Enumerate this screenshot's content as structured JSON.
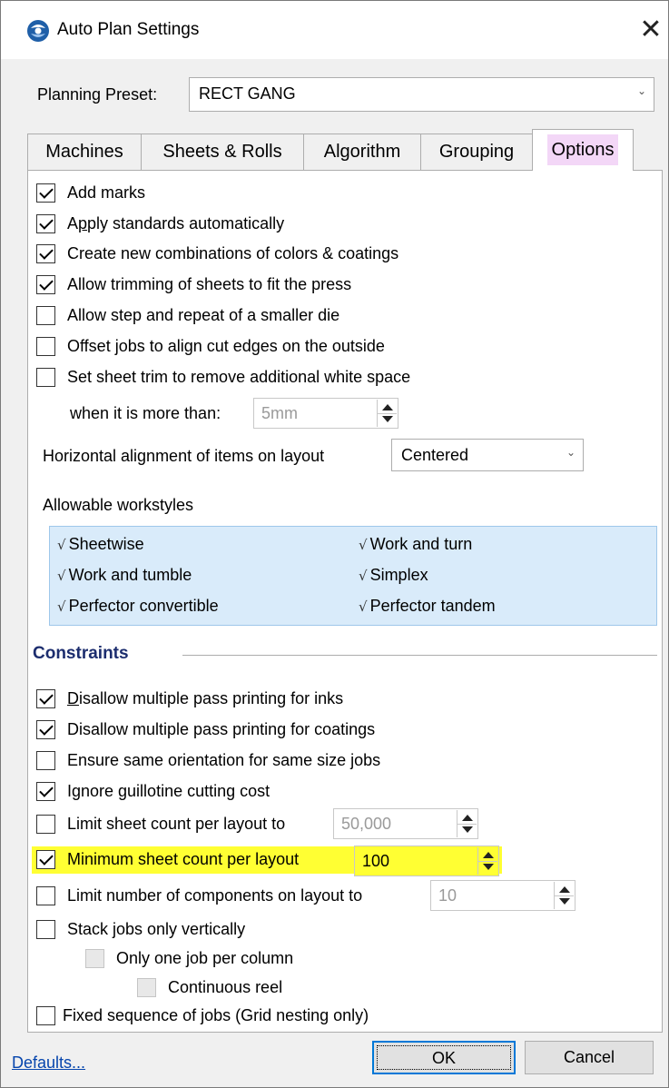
{
  "window": {
    "title": "Auto Plan Settings",
    "close_glyph": "✕"
  },
  "preset": {
    "label": "Planning Preset:",
    "value": "RECT GANG",
    "chevron": "⌄"
  },
  "tabs": [
    {
      "label": "Machines"
    },
    {
      "label": "Sheets & Rolls"
    },
    {
      "label": "Algorithm"
    },
    {
      "label": "Grouping"
    },
    {
      "label": "Options",
      "active": true
    }
  ],
  "options": {
    "add_marks": {
      "label": "Add marks",
      "checked": true
    },
    "apply_standards": {
      "label_pre": "A",
      "label_u": "p",
      "label_post": "ply standards automatically",
      "checked": true
    },
    "create_combinations": {
      "label": "Create new combinations of colors & coatings",
      "checked": true
    },
    "allow_trimming": {
      "label": "Allow trimming of sheets to fit the press",
      "checked": true
    },
    "allow_step_repeat": {
      "label": "Allow step and repeat of a smaller die",
      "checked": false
    },
    "offset_jobs": {
      "label": "Offset jobs to align cut edges on the outside",
      "checked": false
    },
    "set_sheet_trim": {
      "label": "Set sheet trim to remove additional white space",
      "checked": false
    },
    "trim_threshold": {
      "label": "when it is more than:",
      "value": "5mm"
    },
    "horizontal_alignment": {
      "label": "Horizontal alignment of items on layout",
      "value": "Centered",
      "chevron": "⌄"
    },
    "workstyles": {
      "label": "Allowable workstyles",
      "tick": "√",
      "items": [
        "Sheetwise",
        "Work and turn",
        "Work and tumble",
        "Simplex",
        "Perfector convertible",
        "Perfector tandem"
      ]
    }
  },
  "constraints": {
    "title": "Constraints",
    "disallow_inks": {
      "label_u": "D",
      "label_post": "isallow multiple pass printing for inks",
      "checked": true
    },
    "disallow_coatings": {
      "label": "Disallow multiple pass printing for coatings",
      "checked": true
    },
    "ensure_orientation": {
      "label": "Ensure same orientation for same size jobs",
      "checked": false
    },
    "ignore_guillotine": {
      "label": "Ignore guillotine cutting cost",
      "checked": true
    },
    "limit_sheet_count": {
      "label": "Limit sheet count per layout to",
      "checked": false,
      "value": "50,000"
    },
    "minimum_sheet_count": {
      "label": "Minimum sheet count per layout",
      "checked": true,
      "value": "100",
      "highlight": "#ffff33"
    },
    "limit_components": {
      "label": "Limit number of components on layout to",
      "checked": false,
      "value": "10"
    },
    "stack_vertically": {
      "label": "Stack jobs only vertically",
      "checked": false
    },
    "one_job_per_column": {
      "label": "Only one job per column",
      "checked": false
    },
    "continuous_reel": {
      "label": "Continuous reel",
      "checked": false
    },
    "fixed_sequence": {
      "label": "Fixed sequence of jobs (Grid nesting only)",
      "checked": false
    }
  },
  "footer": {
    "defaults_link": "Defaults...",
    "ok_label": "OK",
    "cancel_label": "Cancel"
  },
  "colors": {
    "accent": "#0078d7",
    "tab_highlight": "#f3d7f7",
    "workstyle_bg": "#d9ebfa",
    "group_title": "#1c2d6e"
  }
}
